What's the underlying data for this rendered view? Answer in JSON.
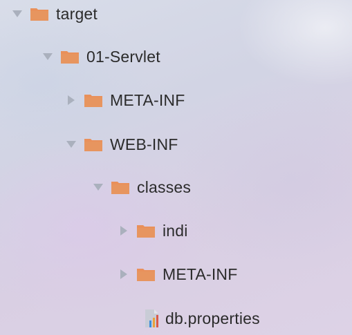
{
  "tree": {
    "items": [
      {
        "label": "target",
        "state": "expanded",
        "icon": "folder-icon"
      },
      {
        "label": "01-Servlet",
        "state": "expanded",
        "icon": "folder-icon"
      },
      {
        "label": "META-INF",
        "state": "collapsed",
        "icon": "folder-icon"
      },
      {
        "label": "WEB-INF",
        "state": "expanded",
        "icon": "folder-icon"
      },
      {
        "label": "classes",
        "state": "expanded",
        "icon": "folder-icon"
      },
      {
        "label": "indi",
        "state": "collapsed",
        "icon": "folder-icon"
      },
      {
        "label": "META-INF",
        "state": "collapsed",
        "icon": "folder-icon"
      },
      {
        "label": "db.properties",
        "state": "file",
        "icon": "properties-file-icon"
      }
    ]
  },
  "colors": {
    "folder": "#e9905a",
    "folder_dark": "#d97b45",
    "arrow": "#aab0bd",
    "text": "#2b2b2b"
  }
}
